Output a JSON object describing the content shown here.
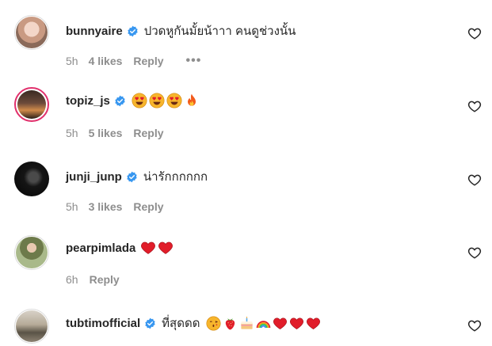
{
  "colors": {
    "verified": "#3897f0",
    "heart_red": "#ed1c24",
    "meta_gray": "#8e8e8e"
  },
  "comments": [
    {
      "username": "bunnyaire",
      "text": "ปวดหูกันมั้ยน้าาา คนดูช่วงนั้น",
      "time": "5h",
      "likes": "4 likes",
      "reply": "Reply",
      "more": "•••",
      "verified": true,
      "emojis": []
    },
    {
      "username": "topiz_js",
      "text": "",
      "time": "5h",
      "likes": "5 likes",
      "reply": "Reply",
      "verified": true,
      "emojis": [
        "heart-eyes-emoji",
        "heart-eyes-emoji",
        "heart-eyes-emoji",
        "fire-emoji"
      ]
    },
    {
      "username": "junji_junp",
      "text": "น่ารักกกกกก",
      "time": "5h",
      "likes": "3 likes",
      "reply": "Reply",
      "verified": true,
      "emojis": []
    },
    {
      "username": "pearpimlada",
      "text": "",
      "time": "6h",
      "reply": "Reply",
      "verified": false,
      "emojis": [
        "red-heart-emoji",
        "red-heart-emoji"
      ]
    },
    {
      "username": "tubtimofficial",
      "text": "ที่สุดดด",
      "verified": true,
      "emojis": [
        "kissing-emoji",
        "strawberry-emoji",
        "cake-emoji",
        "rainbow-emoji",
        "red-heart-emoji",
        "red-heart-emoji",
        "red-heart-emoji"
      ]
    }
  ]
}
